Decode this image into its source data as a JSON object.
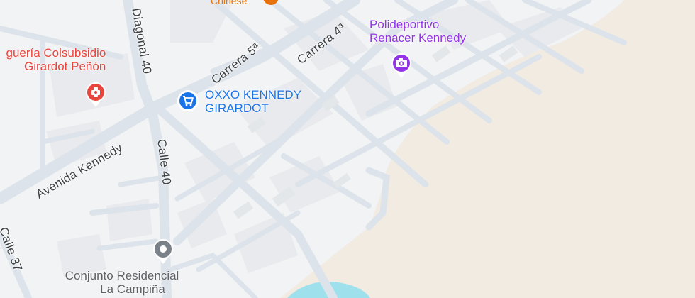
{
  "map": {
    "colors": {
      "land": "#f1f3f4",
      "road": "#dde3ea",
      "block": "#e8eaed",
      "sand": "#f1ebe1",
      "water": "#9ee0ec",
      "poi_red": "#e8453c",
      "poi_blue": "#1a73e8",
      "poi_purple": "#9334e6",
      "poi_gray": "#5f6368",
      "poi_orange": "#e8710a"
    },
    "streets": {
      "diagonal_40": "Diagonal 40",
      "carrera_5a": "Carrera 5ª",
      "carrera_4a": "Carrera 4ª",
      "avenida_kennedy": "Avenida Kennedy",
      "calle_40": "Calle 40",
      "calle_37": "Calle 37"
    },
    "pois": {
      "chinese": {
        "label": "Chinese",
        "icon": "restaurant-icon"
      },
      "drogueria": {
        "line1": "guería Colsubsidio",
        "line2": "Girardot Peñón",
        "icon": "pharmacy-icon"
      },
      "oxxo": {
        "line1": "OXXO KENNEDY",
        "line2": "GIRARDOT",
        "icon": "shopping-cart-icon"
      },
      "polideportivo": {
        "line1": "Polideportivo",
        "line2": "Renacer Kennedy",
        "icon": "camera-icon"
      },
      "conjunto": {
        "line1": "Conjunto Residencial",
        "line2": "La Campiña",
        "icon": "place-icon"
      }
    }
  }
}
